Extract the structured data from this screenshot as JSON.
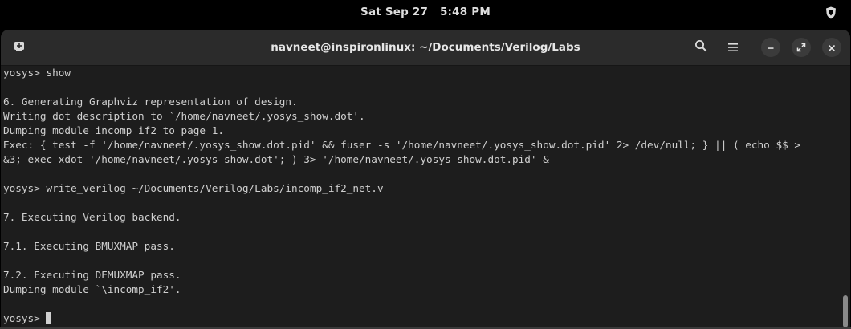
{
  "topbar": {
    "date": "Sat Sep 27",
    "time": "5:48 PM",
    "tray_icon": "shield-icon"
  },
  "window": {
    "title": "navneet@inspironlinux: ~/Documents/Verilog/Labs",
    "new_tab_icon": "new-tab-icon",
    "search_icon": "search-icon",
    "menu_icon": "hamburger-menu-icon",
    "minimize_icon": "minimize-icon",
    "maximize_icon": "maximize-icon",
    "close_icon": "close-icon"
  },
  "terminal": {
    "lines": [
      "yosys> show",
      "",
      "6. Generating Graphviz representation of design.",
      "Writing dot description to `/home/navneet/.yosys_show.dot'.",
      "Dumping module incomp_if2 to page 1.",
      "Exec: { test -f '/home/navneet/.yosys_show.dot.pid' && fuser -s '/home/navneet/.yosys_show.dot.pid' 2> /dev/null; } || ( echo $$ >",
      "&3; exec xdot '/home/navneet/.yosys_show.dot'; ) 3> '/home/navneet/.yosys_show.dot.pid' &",
      "",
      "yosys> write_verilog ~/Documents/Verilog/Labs/incomp_if2_net.v",
      "",
      "7. Executing Verilog backend.",
      "",
      "7.1. Executing BMUXMAP pass.",
      "",
      "7.2. Executing DEMUXMAP pass.",
      "Dumping module `\\incomp_if2'.",
      ""
    ],
    "prompt": "yosys> "
  }
}
